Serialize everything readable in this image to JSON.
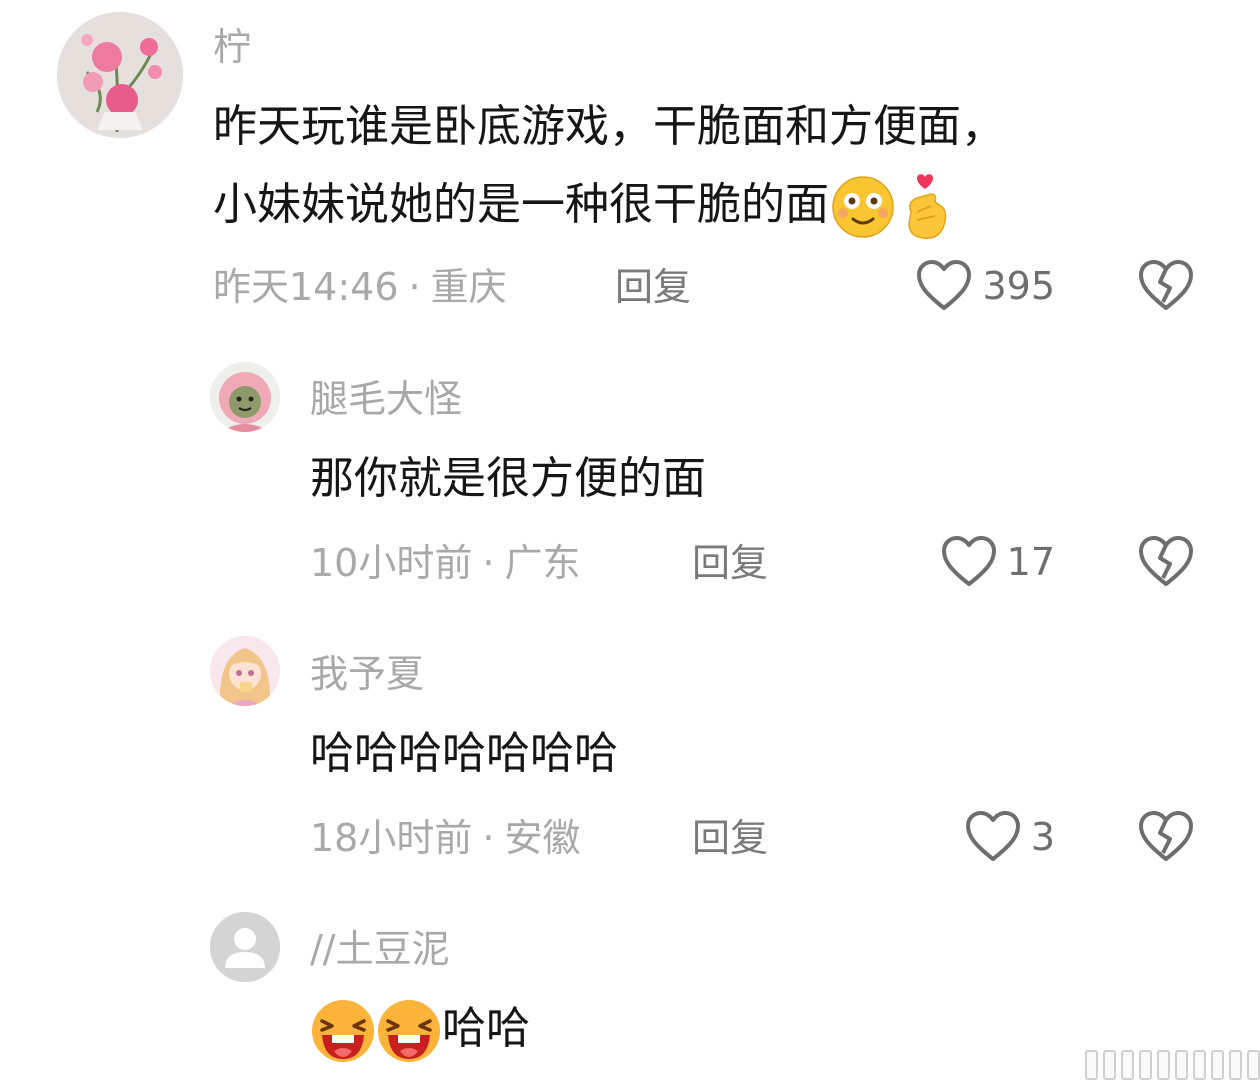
{
  "comments": [
    {
      "username": "柠",
      "avatar": "flower-avatar",
      "text_lines": [
        "昨天玩谁是卧底游戏，干脆面和方便面，",
        "小妹妹说她的是一种很干脆的面"
      ],
      "emojis": [
        "smiling-face-emoji",
        "finger-heart-emoji"
      ],
      "time": "昨天14:46",
      "location": "重庆",
      "reply_label": "回复",
      "likes": "395"
    },
    {
      "username": "腿毛大怪",
      "avatar": "pink-hood-avatar",
      "text": "那你就是很方便的面",
      "time": "10小时前",
      "location": "广东",
      "reply_label": "回复",
      "likes": "17"
    },
    {
      "username": "我予夏",
      "avatar": "anime-girl-avatar",
      "text": "哈哈哈哈哈哈哈",
      "time": "18小时前",
      "location": "安徽",
      "reply_label": "回复",
      "likes": "3"
    },
    {
      "username": "//土豆泥",
      "avatar": "default-user-avatar",
      "emojis": [
        "laughing-face-emoji",
        "laughing-face-emoji"
      ],
      "text": "哈哈"
    }
  ],
  "separator": "·",
  "icons": {
    "like": "heart-outline-icon",
    "dislike": "broken-heart-icon"
  },
  "colors": {
    "username": "#a8a8a8",
    "content": "#161616",
    "meta": "#a9a9a9",
    "reply": "#7a7a7a",
    "icon": "#6e6e6e"
  }
}
